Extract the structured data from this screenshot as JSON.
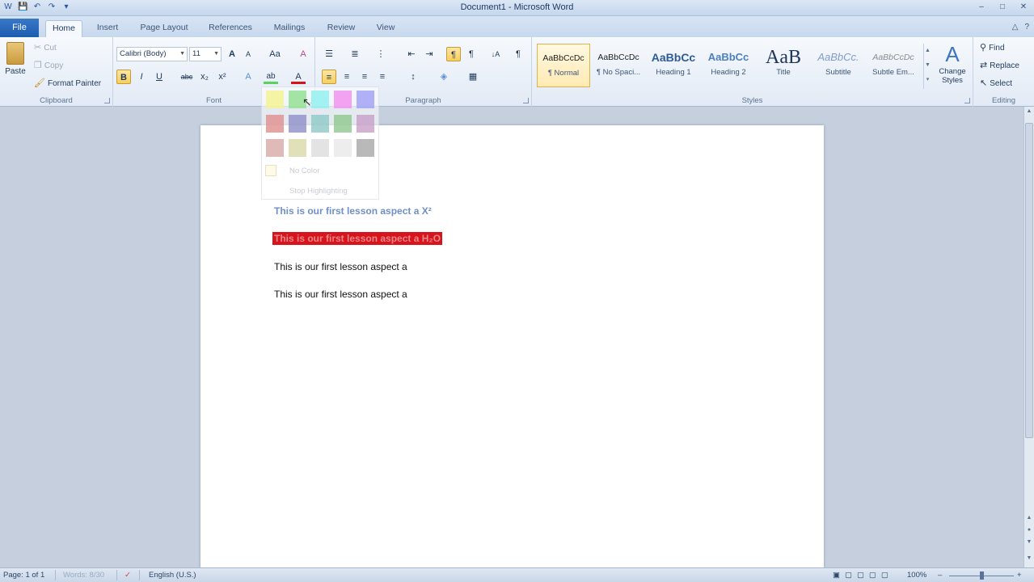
{
  "window": {
    "title": "Document1 - Microsoft Word",
    "qat": [
      "W",
      "💾",
      "↶",
      "↷",
      "▾"
    ],
    "controls": [
      "–",
      "□",
      "✕"
    ]
  },
  "tabs": {
    "file": "File",
    "items": [
      "Home",
      "Insert",
      "Page Layout",
      "References",
      "Mailings",
      "Review",
      "View"
    ],
    "active": "Home",
    "right_icons": [
      "△",
      "?"
    ]
  },
  "clipboard": {
    "label": "Clipboard",
    "paste": "Paste",
    "cut": "Cut",
    "copy": "Copy",
    "format_painter": "Format Painter"
  },
  "font": {
    "label": "Font",
    "family": "Calibri (Body)",
    "size": "11",
    "grow": "A",
    "shrink": "A",
    "change_case": "Aa",
    "clear": "A",
    "bold": "B",
    "italic": "I",
    "underline": "U",
    "strike": "abc",
    "subscript": "x₂",
    "superscript": "x²",
    "text_effects": "A",
    "highlight": "ab",
    "font_color": "A"
  },
  "paragraph": {
    "label": "Paragraph",
    "pilcrow": "¶",
    "sort": "↓A"
  },
  "styles": {
    "label": "Styles",
    "items": [
      {
        "sample": "AaBbCcDc",
        "name": "¶ Normal"
      },
      {
        "sample": "AaBbCcDc",
        "name": "¶ No Spaci..."
      },
      {
        "sample": "AaBbCc",
        "name": "Heading 1"
      },
      {
        "sample": "AaBbCc",
        "name": "Heading 2"
      },
      {
        "sample": "AaB",
        "name": "Title"
      },
      {
        "sample": "AaBbCc.",
        "name": "Subtitle"
      },
      {
        "sample": "AaBbCcDc",
        "name": "Subtle Em..."
      }
    ],
    "change_styles": "Change Styles"
  },
  "editing": {
    "label": "Editing",
    "find": "Find",
    "replace": "Replace",
    "select": "Select"
  },
  "highlight_menu": {
    "swatches": [
      "#f4f48f",
      "#8fe08f",
      "#8ff0f0",
      "#f08ff0",
      "#9f9ff5",
      "#e08f8f",
      "#8f8fc8",
      "#8fc8c8",
      "#8fc88f",
      "#c89fc8",
      "#d8a8a8",
      "#d8d8a8",
      "#dcdcdc",
      "#e8e8e8",
      "#a8a8a8"
    ],
    "no_color": "No Color",
    "stop": "Stop Highlighting"
  },
  "document": {
    "p1": "This is our first lesson aspect a X²",
    "p2": "This is our first lesson aspect a H₂O",
    "p3": "This is our first lesson aspect a",
    "p4": "This is our first lesson aspect a"
  },
  "status": {
    "page": "Page: 1 of 1",
    "words": "Words: 8/30",
    "language": "English (U.S.)",
    "zoom": "100%"
  }
}
